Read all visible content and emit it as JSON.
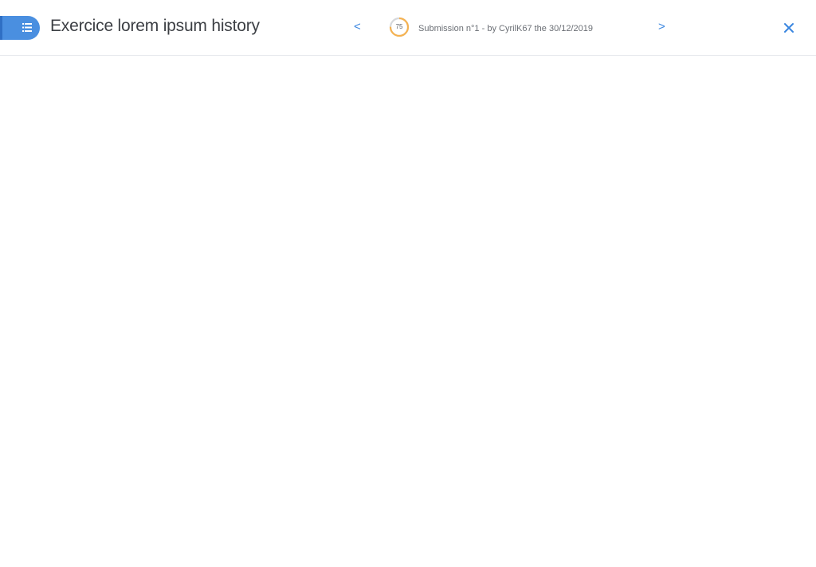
{
  "header": {
    "menu_icon": "list-icon",
    "title": "Exercice lorem ipsum history",
    "prev_label": "<",
    "next_label": ">",
    "score": {
      "value": "75",
      "progress": 0.75,
      "track_color": "#d6d8db",
      "fill_color": "#f5b251"
    },
    "submission_text": "Submission n°1 - by CyrilK67 the 30/12/2019",
    "close_icon": "close-icon"
  },
  "colors": {
    "accent": "#3a86e0",
    "menu_bg": "#4a8fe0"
  }
}
